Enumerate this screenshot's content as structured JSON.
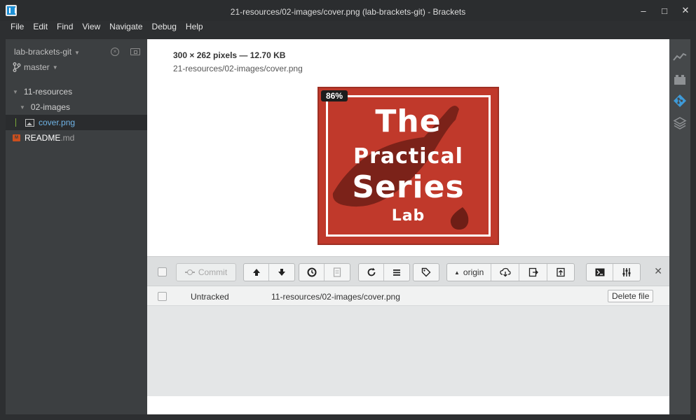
{
  "window": {
    "title": "21-resources/02-images/cover.png (lab-brackets-git) - Brackets",
    "controls": {
      "minimize": "–",
      "maximize": "□",
      "close": "✕"
    }
  },
  "menu": [
    "File",
    "Edit",
    "Find",
    "View",
    "Navigate",
    "Debug",
    "Help"
  ],
  "sidebar": {
    "project_name": "lab-brackets-git",
    "branch": "master",
    "tree": [
      {
        "label": "11-resources",
        "type": "folder"
      },
      {
        "label": "02-images",
        "type": "folder"
      },
      {
        "label": "cover.png",
        "type": "image",
        "selected": true
      },
      {
        "name": "README",
        "ext": ".md",
        "type": "markdown"
      }
    ]
  },
  "image_view": {
    "info": "300 × 262 pixels — 12.70 KB",
    "path": "21-resources/02-images/cover.png",
    "zoom": "86%",
    "cover_text": {
      "line1": "The",
      "line2": "Practical",
      "line3": "Series",
      "line4": "Lab"
    }
  },
  "git_panel": {
    "commit_label": "Commit",
    "remote_label": "origin",
    "files": [
      {
        "status": "Untracked",
        "path": "11-resources/02-images/cover.png",
        "action": "Delete file"
      }
    ]
  },
  "right_toolbar": [
    "live-preview-icon",
    "extension-manager-icon",
    "git-icon",
    "layers-icon"
  ],
  "colors": {
    "sidebar_bg": "#3c3f41",
    "selected_file": "#6fb3e5",
    "cover_red": "#c0392b",
    "git_accent": "#1e90d6"
  }
}
